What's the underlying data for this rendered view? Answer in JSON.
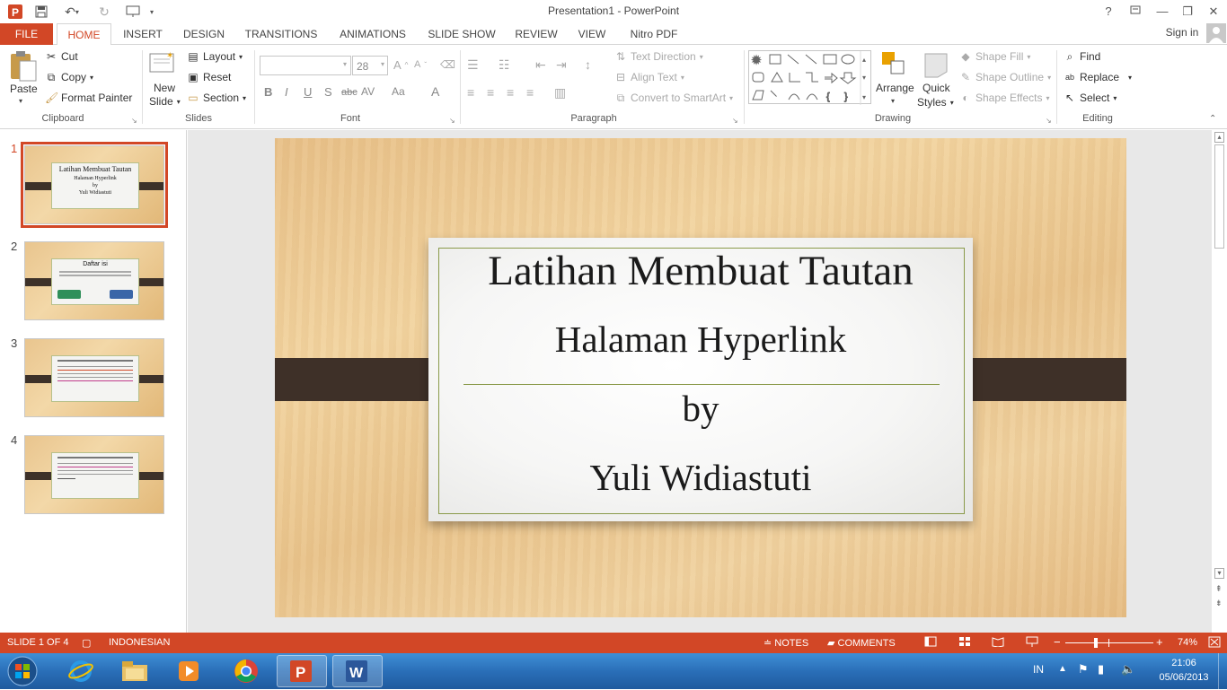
{
  "window": {
    "title": "Presentation1 - PowerPoint",
    "help": "?",
    "sign_in": "Sign in"
  },
  "tabs": [
    "FILE",
    "HOME",
    "INSERT",
    "DESIGN",
    "TRANSITIONS",
    "ANIMATIONS",
    "SLIDE SHOW",
    "REVIEW",
    "VIEW",
    "Nitro PDF"
  ],
  "active_tab": "HOME",
  "ribbon": {
    "clipboard": {
      "label": "Clipboard",
      "paste": "Paste",
      "cut": "Cut",
      "copy": "Copy",
      "format_painter": "Format Painter"
    },
    "slides": {
      "label": "Slides",
      "new_slide_1": "New",
      "new_slide_2": "Slide",
      "layout": "Layout",
      "reset": "Reset",
      "section": "Section"
    },
    "font": {
      "label": "Font",
      "size": "28",
      "bold": "B",
      "italic": "I",
      "underline": "U",
      "shadow": "S",
      "strike": "abc",
      "spacing": "AV",
      "case": "Aa",
      "color": "A"
    },
    "paragraph": {
      "label": "Paragraph",
      "text_direction": "Text Direction",
      "align_text": "Align Text",
      "convert": "Convert to SmartArt"
    },
    "drawing": {
      "label": "Drawing",
      "arrange": "Arrange",
      "quick_styles_1": "Quick",
      "quick_styles_2": "Styles",
      "shape_fill": "Shape Fill",
      "shape_outline": "Shape Outline",
      "shape_effects": "Shape Effects"
    },
    "editing": {
      "label": "Editing",
      "find": "Find",
      "replace": "Replace",
      "select": "Select"
    }
  },
  "thumbnails": [
    {
      "num": "1",
      "title": "Latihan Membuat  Tautan",
      "l2": "Halaman Hyperlink",
      "l3": "by",
      "l4": "Yuli Widiastuti"
    },
    {
      "num": "2",
      "title": "Daftar isi"
    },
    {
      "num": "3"
    },
    {
      "num": "4"
    }
  ],
  "slide": {
    "line1": "Latihan Membuat  Tautan",
    "line2": "Halaman Hyperlink",
    "line3": "by",
    "line4": "Yuli Widiastuti"
  },
  "status": {
    "slide_of": "SLIDE 1 OF 4",
    "language": "INDONESIAN",
    "notes": "NOTES",
    "comments": "COMMENTS",
    "zoom": "74%"
  },
  "taskbar": {
    "lang": "IN",
    "time": "21:06",
    "date": "05/06/2013"
  },
  "colors": {
    "accent": "#d24726",
    "slide_rule": "#8a9a4a",
    "strap": "#3e3028"
  }
}
